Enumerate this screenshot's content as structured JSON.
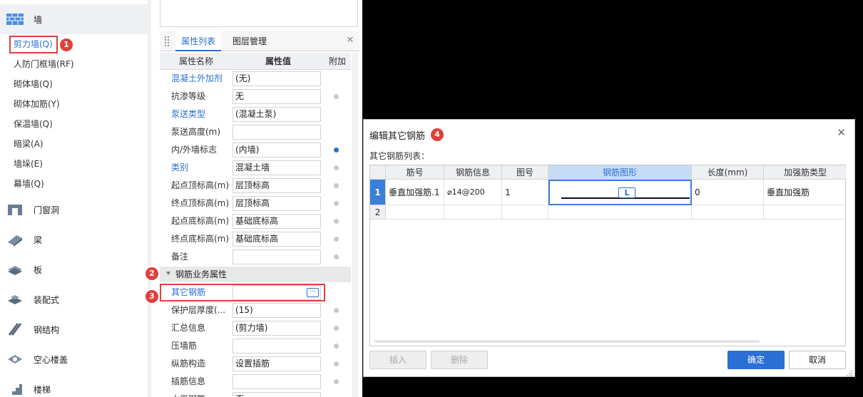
{
  "sidebar": {
    "wall_category": "墙",
    "wall_items": [
      {
        "label": "剪力墙(Q)"
      },
      {
        "label": "人防门框墙(RF)"
      },
      {
        "label": "砌体墙(Q)"
      },
      {
        "label": "砌体加筋(Y)"
      },
      {
        "label": "保温墙(Q)"
      },
      {
        "label": "暗梁(A)"
      },
      {
        "label": "墙垛(E)"
      },
      {
        "label": "幕墙(Q)"
      }
    ],
    "categories": [
      {
        "label": "门窗洞",
        "icon": "door-window-icon"
      },
      {
        "label": "梁",
        "icon": "beam-icon"
      },
      {
        "label": "板",
        "icon": "slab-icon"
      },
      {
        "label": "装配式",
        "icon": "prefab-icon"
      },
      {
        "label": "钢结构",
        "icon": "steel-structure-icon"
      },
      {
        "label": "空心楼盖",
        "icon": "hollow-floor-icon"
      },
      {
        "label": "楼梯",
        "icon": "stair-icon"
      }
    ]
  },
  "property_panel": {
    "tabs": [
      "属性列表",
      "图层管理"
    ],
    "columns": {
      "name": "属性名称",
      "value": "属性值",
      "extra": "附加"
    },
    "rows": [
      {
        "name": "混凝土外加剂",
        "value": "(无)",
        "blue": true,
        "dot": ""
      },
      {
        "name": "抗渗等级",
        "value": "无",
        "blue": false,
        "dot": "grey"
      },
      {
        "name": "泵送类型",
        "value": "(混凝土泵)",
        "blue": true,
        "dot": ""
      },
      {
        "name": "泵送高度(m)",
        "value": "",
        "blue": false,
        "dot": ""
      },
      {
        "name": "内/外墙标志",
        "value": "(内墙)",
        "blue": false,
        "dot": "blue"
      },
      {
        "name": "类别",
        "value": "混凝土墙",
        "blue": true,
        "dot": "grey"
      },
      {
        "name": "起点顶标高(m)",
        "value": "层顶标高",
        "blue": false,
        "dot": "grey"
      },
      {
        "name": "终点顶标高(m)",
        "value": "层顶标高",
        "blue": false,
        "dot": "grey"
      },
      {
        "name": "起点底标高(m)",
        "value": "基础底标高",
        "blue": false,
        "dot": "grey"
      },
      {
        "name": "终点底标高(m)",
        "value": "基础底标高",
        "blue": false,
        "dot": "grey"
      },
      {
        "name": "备注",
        "value": "",
        "blue": false,
        "dot": "grey"
      }
    ],
    "group_title": "钢筋业务属性",
    "rows2": [
      {
        "name": "其它钢筋",
        "value": "",
        "blue": true,
        "dot": ""
      },
      {
        "name": "保护层厚度(...",
        "value": "(15)",
        "blue": false,
        "dot": "grey"
      },
      {
        "name": "汇总信息",
        "value": "(剪力墙)",
        "blue": false,
        "dot": "grey"
      },
      {
        "name": "压墙筋",
        "value": "",
        "blue": false,
        "dot": "grey"
      },
      {
        "name": "纵筋构造",
        "value": "设置插筋",
        "blue": false,
        "dot": "grey"
      },
      {
        "name": "插筋信息",
        "value": "",
        "blue": false,
        "dot": "grey"
      },
      {
        "name": "水平钢筋...",
        "value": "否",
        "blue": false,
        "dot": ""
      }
    ],
    "ellipsis": "···"
  },
  "badges": [
    "1",
    "2",
    "3",
    "4"
  ],
  "dialog": {
    "title": "编辑其它钢筋",
    "list_label": "其它钢筋列表：",
    "columns": [
      "筋号",
      "钢筋信息",
      "图号",
      "钢筋图形",
      "长度(mm)",
      "加强筋类型"
    ],
    "rows": [
      {
        "num": "1",
        "name": "垂直加强筋.1",
        "info": "⌀14@200",
        "fig": "1",
        "shape_label": "L",
        "length": "0",
        "type": "垂直加强筋"
      },
      {
        "num": "2",
        "name": "",
        "info": "",
        "fig": "",
        "shape_label": "",
        "length": "",
        "type": ""
      }
    ],
    "buttons": {
      "insert": "插入",
      "delete": "删除",
      "ok": "确定",
      "cancel": "取消"
    },
    "close": "✕"
  },
  "colors": {
    "accent": "#2a6fd4",
    "highlight": "#e0403c"
  }
}
